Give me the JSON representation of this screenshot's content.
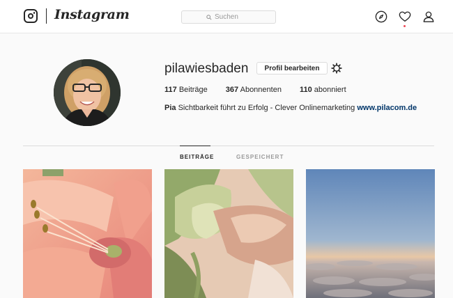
{
  "header": {
    "logo_text": "Instagram",
    "search_placeholder": "Suchen",
    "icons": [
      "instagram-glyph-icon",
      "compass-icon",
      "heart-icon",
      "user-icon"
    ],
    "notification_color": "#ed4956"
  },
  "profile": {
    "username": "pilawiesbaden",
    "edit_label": "Profil bearbeiten",
    "stats": {
      "posts_count": "117",
      "posts_label": "Beiträge",
      "followers_count": "367",
      "followers_label": "Abonnenten",
      "following_count": "110",
      "following_label": "abonniert"
    },
    "bio": {
      "name": "Pia",
      "text": "Sichtbarkeit führt zu Erfolg - Clever Onlinemarketing",
      "link": "www.pilacom.de"
    }
  },
  "tabs": [
    {
      "label": "BEITRÄGE",
      "active": true
    },
    {
      "label": "GESPEICHERT",
      "active": false
    }
  ],
  "posts": [
    {
      "subject": "pink-amaryllis-flower"
    },
    {
      "subject": "green-peach-orchid-bud"
    },
    {
      "subject": "sky-above-clouds"
    }
  ],
  "colors": {
    "text": "#262626",
    "secondary_text": "#999999",
    "link": "#003569",
    "border": "#dbdbdb",
    "background": "#fafafa"
  }
}
